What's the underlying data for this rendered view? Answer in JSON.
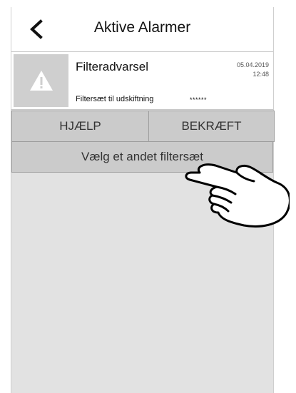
{
  "header": {
    "title": "Aktive Alarmer",
    "back_icon": "chevron-left-icon"
  },
  "alarm": {
    "icon": "warning-triangle-icon",
    "title": "Filteradvarsel",
    "date": "05.04.2019",
    "time": "12:48",
    "description": "Filtersæt til udskiftning",
    "masked_value": "******"
  },
  "actions": {
    "help_label": "HJÆLP",
    "confirm_label": "BEKRÆFT",
    "select_filter_label": "Vælg et andet filtersæt"
  },
  "overlay": {
    "pointer_icon": "pointing-hand-icon"
  },
  "colors": {
    "background": "#e2e2e2",
    "button": "#cbcbcb",
    "icon_box": "#cfcfcf"
  }
}
